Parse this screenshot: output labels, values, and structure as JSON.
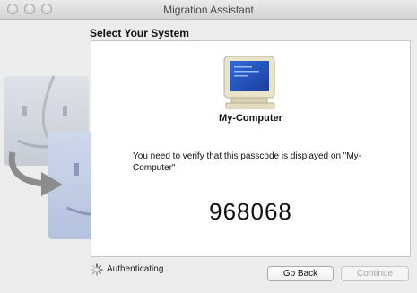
{
  "window": {
    "title": "Migration Assistant"
  },
  "panel": {
    "title": "Select Your System",
    "computer_name": "My-Computer",
    "message": "You need to verify that this passcode is displayed on \"My-Computer\"",
    "passcode": "968068"
  },
  "status": {
    "text": "Authenticating..."
  },
  "buttons": {
    "back": "Go Back",
    "continue": "Continue"
  },
  "icons": {
    "close": "close-button-icon",
    "minimize": "minimize-button-icon",
    "zoom": "zoom-button-icon",
    "monitor": "crt-monitor-icon",
    "finder": "finder-face-icon",
    "arrow": "transfer-arrow-icon",
    "spinner": "progress-spinner-icon"
  }
}
